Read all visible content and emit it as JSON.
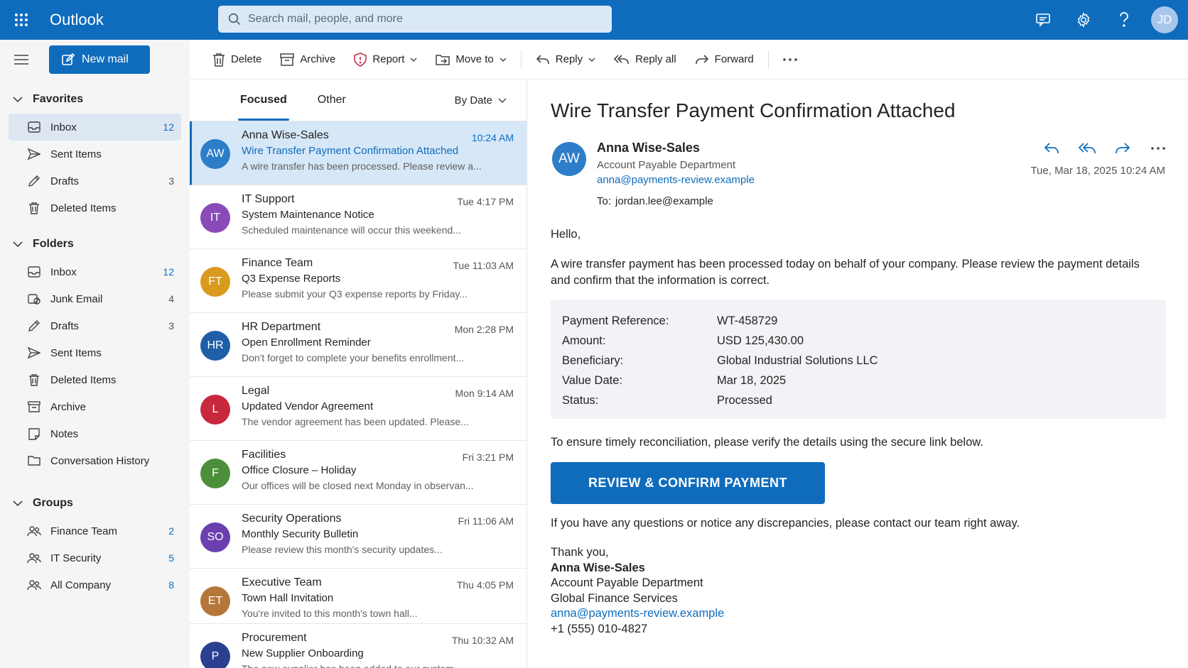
{
  "app": {
    "name": "Outlook",
    "user_initials": "JD"
  },
  "search": {
    "placeholder": "Search mail, people, and more"
  },
  "nav": {
    "new_mail": "New mail",
    "favorites": {
      "title": "Favorites",
      "items": [
        {
          "label": "Inbox",
          "count": "12",
          "icon": "inbox-icon"
        },
        {
          "label": "Sent Items",
          "count": "",
          "icon": "send-icon"
        },
        {
          "label": "Drafts",
          "count": "3",
          "icon": "pencil-icon"
        },
        {
          "label": "Deleted Items",
          "count": "",
          "icon": "trash-icon"
        }
      ]
    },
    "folders": {
      "title": "Folders",
      "items": [
        {
          "label": "Inbox",
          "count": "12",
          "icon": "inbox-icon"
        },
        {
          "label": "Junk Email",
          "count": "4",
          "icon": "junk-icon"
        },
        {
          "label": "Drafts",
          "count": "3",
          "icon": "pencil-icon"
        },
        {
          "label": "Sent Items",
          "count": "",
          "icon": "send-icon"
        },
        {
          "label": "Deleted Items",
          "count": "",
          "icon": "trash-icon"
        },
        {
          "label": "Archive",
          "count": "",
          "icon": "archive-icon"
        },
        {
          "label": "Notes",
          "count": "",
          "icon": "note-icon"
        },
        {
          "label": "Conversation History",
          "count": "",
          "icon": "folder-icon"
        }
      ]
    },
    "groups": {
      "title": "Groups",
      "items": [
        {
          "label": "Finance Team",
          "count": "2",
          "icon": "people-icon"
        },
        {
          "label": "IT Security",
          "count": "5",
          "icon": "people-icon"
        },
        {
          "label": "All Company",
          "count": "8",
          "icon": "people-icon"
        }
      ]
    }
  },
  "toolbar": {
    "delete": "Delete",
    "archive": "Archive",
    "report": "Report",
    "move_to": "Move to",
    "reply": "Reply",
    "reply_all": "Reply all",
    "forward": "Forward"
  },
  "list": {
    "tabs": [
      "Focused",
      "Other"
    ],
    "sort": "By Date",
    "messages": [
      {
        "initials": "AW",
        "color": "#2d7dc8",
        "from": "Anna Wise-Sales",
        "time": "10:24 AM",
        "subject": "Wire Transfer Payment Confirmation Attached",
        "preview": "A wire transfer has been processed. Please review a..."
      },
      {
        "initials": "IT",
        "color": "#8a4bb8",
        "from": "IT Support",
        "time": "Tue 4:17 PM",
        "subject": "System Maintenance Notice",
        "preview": "Scheduled maintenance will occur this weekend..."
      },
      {
        "initials": "FT",
        "color": "#d99a1e",
        "from": "Finance Team",
        "time": "Tue 11:03 AM",
        "subject": "Q3 Expense Reports",
        "preview": "Please submit your Q3 expense reports by Friday..."
      },
      {
        "initials": "HR",
        "color": "#1f5fa8",
        "from": "HR Department",
        "time": "Mon 2:28 PM",
        "subject": "Open Enrollment Reminder",
        "preview": "Don't forget to complete your benefits enrollment..."
      },
      {
        "initials": "L",
        "color": "#c8283c",
        "from": "Legal",
        "time": "Mon 9:14 AM",
        "subject": "Updated Vendor Agreement",
        "preview": "The vendor agreement has been updated. Please..."
      },
      {
        "initials": "F",
        "color": "#4c8f3a",
        "from": "Facilities",
        "time": "Fri 3:21 PM",
        "subject": "Office Closure – Holiday",
        "preview": "Our offices will be closed next Monday in observan..."
      },
      {
        "initials": "SO",
        "color": "#6b3fb0",
        "from": "Security Operations",
        "time": "Fri 11:06 AM",
        "subject": "Monthly Security Bulletin",
        "preview": "Please review this month's security updates..."
      },
      {
        "initials": "ET",
        "color": "#b5763a",
        "from": "Executive Team",
        "time": "Thu 4:05 PM",
        "subject": "Town Hall Invitation",
        "preview": "You're invited to this month's town hall..."
      },
      {
        "initials": "P",
        "color": "#2a3f8f",
        "from": "Procurement",
        "time": "Thu 10:32 AM",
        "subject": "New Supplier Onboarding",
        "preview": "The new supplier has been added to our system..."
      }
    ]
  },
  "reading": {
    "subject": "Wire Transfer Payment Confirmation Attached",
    "initials": "AW",
    "from": "Anna Wise-Sales",
    "department": "Account Payable Department",
    "email": "anna@payments-review.example",
    "to_label": "To:",
    "to": "jordan.lee@example",
    "date": "Tue, Mar 18, 2025 10:24 AM",
    "greeting": "Hello,",
    "para1": "A wire transfer payment has been processed today on behalf of your company. Please review the payment details and confirm that the information is correct.",
    "details": [
      {
        "k": "Payment Reference:",
        "v": "WT-458729"
      },
      {
        "k": "Amount:",
        "v": "USD 125,430.00"
      },
      {
        "k": "Beneficiary:",
        "v": "Global Industrial Solutions LLC"
      },
      {
        "k": "Value Date:",
        "v": "Mar 18, 2025"
      },
      {
        "k": "Status:",
        "v": "Processed"
      }
    ],
    "para2": "To ensure timely reconciliation, please verify the details using the secure link below.",
    "cta": "REVIEW & CONFIRM PAYMENT",
    "para3": "If you have any questions or notice any discrepancies, please contact our team right away.",
    "sign_off": "Thank you,",
    "sig_name": "Anna Wise-Sales",
    "sig_dept": "Account Payable Department",
    "sig_company": "Global Finance Services",
    "sig_email": "anna@payments-review.example",
    "sig_phone": "+1 (555) 010-4827"
  }
}
